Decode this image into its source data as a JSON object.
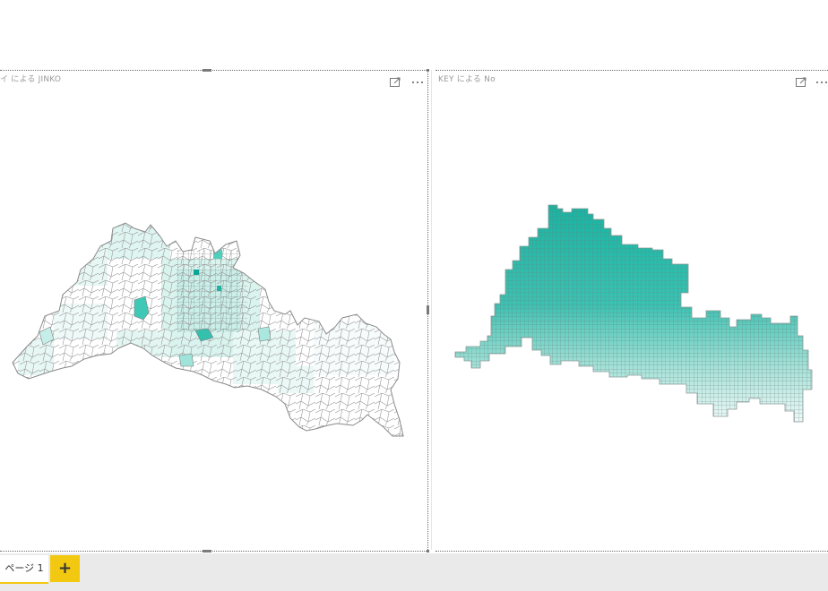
{
  "visuals": {
    "left": {
      "title": "イ による JINKO",
      "focus_icon": "focus-mode-icon",
      "more_icon": "more-options-icon",
      "fill_light": "#eaf8f6",
      "fill_mid": "#bfece5",
      "fill_dark": "#2bbfae",
      "stroke": "#8a8a8a"
    },
    "right": {
      "title": "KEY による No",
      "focus_icon": "focus-mode-icon",
      "more_icon": "more-options-icon",
      "fill_top": "#21b8a6",
      "fill_bottom": "#ffffff",
      "stroke": "#7f8c8a"
    }
  },
  "page_tabs": {
    "pages": [
      {
        "label": "ページ 1",
        "active": true
      }
    ],
    "add_label": "+",
    "accent": "#f2c811"
  }
}
